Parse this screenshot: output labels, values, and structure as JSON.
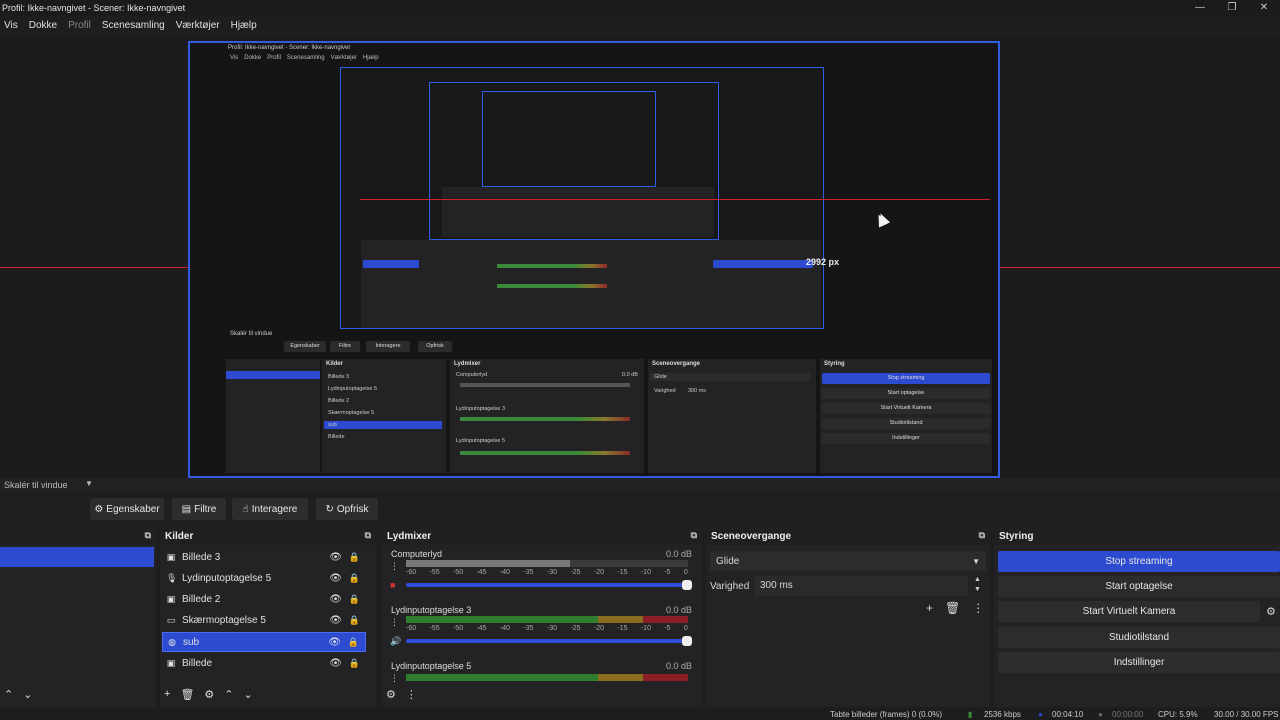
{
  "window": {
    "title": "Profil: Ikke-navngivet - Scener: Ikke-navngivet",
    "controls": [
      "—",
      "❐",
      "✕"
    ]
  },
  "menu": {
    "items": [
      "Vis",
      "Dokke",
      "Profil",
      "Scenesamling",
      "Værktøjer",
      "Hjælp"
    ]
  },
  "preview": {
    "measure_label": "2992 px",
    "nested_title": "Profil: Ikke-navngivet - Scener: Ikke-navngivet",
    "nested_menu": [
      "Vis",
      "Dokke",
      "Profil",
      "Scenesamling",
      "Værktøjer",
      "Hjælp"
    ],
    "nested_scale_label": "Skalér til vindue",
    "nested_toolbar": [
      "Egenskaber",
      "Filtre",
      "Interagere",
      "Opfrisk"
    ],
    "nested_headers": [
      "Kilder",
      "Lydmixer",
      "Sceneovergange",
      "Styring"
    ],
    "nested_sources": [
      "Billede 3",
      "Lydinputoptagelse 5",
      "Billede 2",
      "Skærmoptagelse 5",
      "sub",
      "Billede"
    ],
    "nested_mixer": [
      "Computerlyd",
      "Lydinputoptagelse 3",
      "Lydinputoptagelse 5"
    ],
    "nested_mixer_db": "0.0 dB",
    "nested_transition": "Glide",
    "nested_duration_label": "Varighed",
    "nested_duration": "300 ms",
    "nested_controls": [
      "Stop streaming",
      "Start optagelse",
      "Start Virtuelt Kamera",
      "Studiotilstand",
      "Indstillinger"
    ]
  },
  "scale_bar": {
    "label": "Skalér til vindue"
  },
  "source_toolbar": {
    "properties": "Egenskaber",
    "filters": "Filtre",
    "interact": "Interagere",
    "refresh": "Opfrisk"
  },
  "sources": {
    "title": "Kilder",
    "items": [
      {
        "label": "Billede 3",
        "icon": "image-icon",
        "glyph": "▣"
      },
      {
        "label": "Lydinputoptagelse 5",
        "icon": "mic-icon",
        "glyph": "🎙"
      },
      {
        "label": "Billede 2",
        "icon": "image-icon",
        "glyph": "▣"
      },
      {
        "label": "Skærmoptagelse 5",
        "icon": "monitor-icon",
        "glyph": "▭"
      },
      {
        "label": "sub",
        "icon": "globe-icon",
        "glyph": "◍"
      },
      {
        "label": "Billede",
        "icon": "image-icon",
        "glyph": "▣"
      }
    ],
    "selected_index": 4
  },
  "mixer": {
    "title": "Lydmixer",
    "scale_ticks": [
      "-60",
      "-55",
      "-50",
      "-45",
      "-40",
      "-35",
      "-30",
      "-25",
      "-20",
      "-15",
      "-10",
      "-5",
      "0"
    ],
    "channels": [
      {
        "name": "Computerlyd",
        "db": "0.0 dB",
        "level": 0.58
      },
      {
        "name": "Lydinputoptagelse 3",
        "db": "0.0 dB",
        "level": 1.0
      },
      {
        "name": "Lydinputoptagelse 5",
        "db": "0.0 dB",
        "level": 1.0
      }
    ]
  },
  "transitions": {
    "title": "Sceneovergange",
    "selected": "Glide",
    "duration_label": "Varighed",
    "duration": "300 ms"
  },
  "controls": {
    "title": "Styring",
    "buttons": [
      "Stop streaming",
      "Start optagelse",
      "Start Virtuelt Kamera",
      "Studiotilstand",
      "Indstillinger"
    ]
  },
  "status": {
    "dropped": "Tabte billeder (frames) 0 (0.0%)",
    "bitrate": "2536 kbps",
    "stream_time": "00:04:10",
    "rec_time": "00:00:00",
    "cpu": "CPU: 5.9%",
    "fps": "30.00 / 30.00 FPS"
  },
  "colors": {
    "accent": "#2c4bd0",
    "meter_green": "#3b8a3b",
    "meter_yellow": "#8a7a2a",
    "meter_red": "#8a2a2a",
    "guide_red": "#d0202a"
  }
}
